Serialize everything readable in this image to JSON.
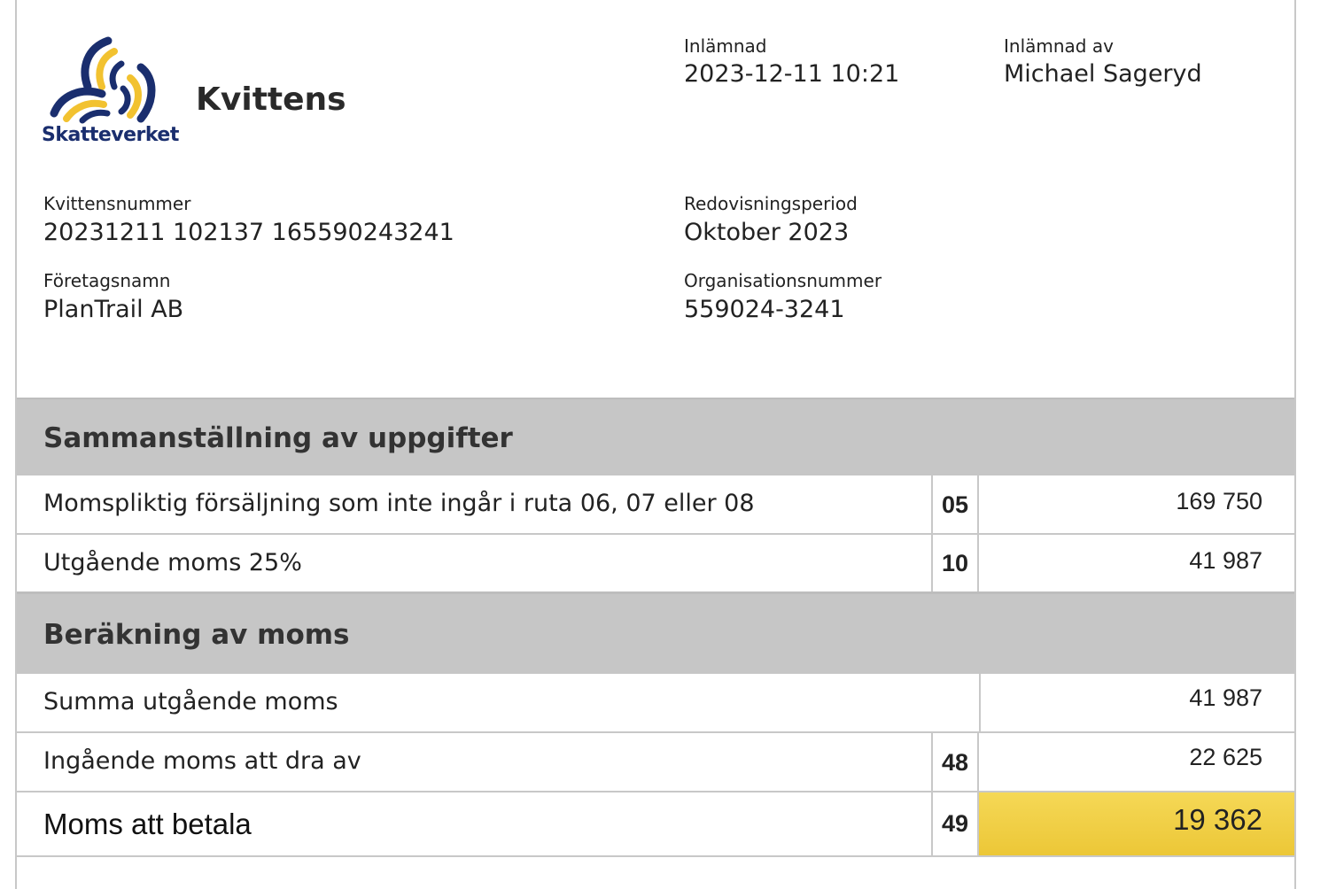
{
  "header": {
    "logo_text": "Skatteverket",
    "title": "Kvittens",
    "inlamnad_label": "Inlämnad",
    "inlamnad_value": "2023-12-11 10:21",
    "inlamnad_av_label": "Inlämnad av",
    "inlamnad_av_value": "Michael Sageryd"
  },
  "details": {
    "kvittensnummer_label": "Kvittensnummer",
    "kvittensnummer_value": "20231211 102137 165590243241",
    "period_label": "Redovisningsperiod",
    "period_value": "Oktober 2023",
    "foretag_label": "Företagsnamn",
    "foretag_value": "PlanTrail AB",
    "orgnr_label": "Organisationsnummer",
    "orgnr_value": "559024-3241"
  },
  "colors": {
    "logo_blue": "#1a2e6e",
    "logo_yellow": "#f2c230",
    "section_band": "#c6c6c6",
    "highlight": "#f0cc40"
  },
  "sections": {
    "summary": {
      "title": "Sammanställning av uppgifter",
      "rows": [
        {
          "desc": "Momspliktig försäljning som inte ingår i ruta 06, 07 eller 08",
          "code": "05",
          "amount": "169 750"
        },
        {
          "desc": "Utgående moms 25%",
          "code": "10",
          "amount": "41 987"
        }
      ]
    },
    "calc": {
      "title": "Beräkning av moms",
      "rows": [
        {
          "desc": "Summa utgående moms",
          "code": "",
          "amount": "41 987"
        },
        {
          "desc": "Ingående moms att dra av",
          "code": "48",
          "amount": "22 625"
        },
        {
          "desc": "Moms att betala",
          "code": "49",
          "amount": "19 362"
        }
      ]
    }
  }
}
